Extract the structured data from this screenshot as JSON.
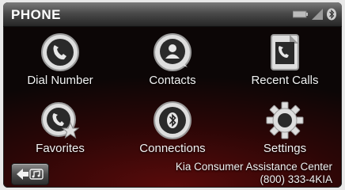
{
  "header": {
    "title": "PHONE"
  },
  "tiles": [
    {
      "label": "Dial Number"
    },
    {
      "label": "Contacts"
    },
    {
      "label": "Recent Calls"
    },
    {
      "label": "Favorites"
    },
    {
      "label": "Connections"
    },
    {
      "label": "Settings"
    }
  ],
  "footer": {
    "assist_title": "Kia Consumer Assistance Center",
    "assist_phone": "(800) 333-4KIA"
  },
  "icons": {
    "battery": "battery-icon",
    "signal": "signal-icon",
    "bluetooth": "bluetooth-icon",
    "back": "back-icon"
  }
}
